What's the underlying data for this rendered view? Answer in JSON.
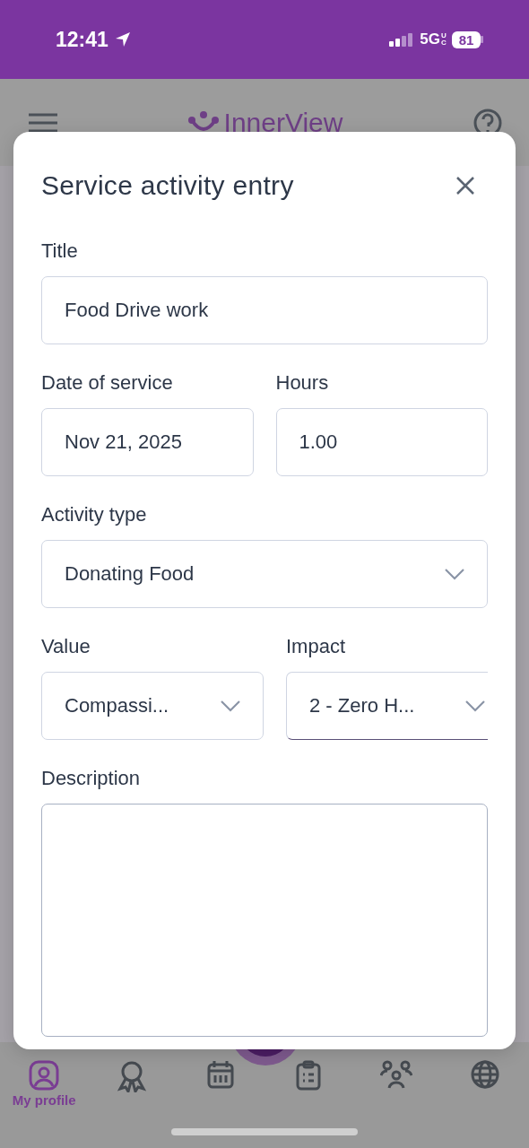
{
  "status_bar": {
    "time": "12:41",
    "network": "5G",
    "network_suffix": "UC",
    "battery": "81"
  },
  "app_header": {
    "logo": "InnerView"
  },
  "modal": {
    "title": "Service activity entry",
    "rows": [
      [
        {
          "kind": "text",
          "label": "Title",
          "value": "Food Drive work",
          "focused": false
        }
      ],
      [
        {
          "kind": "date",
          "label": "Date of service",
          "value": "Nov 21, 2025",
          "focused": false
        },
        {
          "kind": "number",
          "label": "Hours",
          "value": "1.00",
          "focused": false
        }
      ],
      [
        {
          "kind": "select",
          "label": "Activity type",
          "value": "Donating Food",
          "focused": false
        }
      ],
      [
        {
          "kind": "select",
          "label": "Value",
          "value": "Compassi...",
          "focused": false
        },
        {
          "kind": "select",
          "label": "Impact",
          "value": "2 - Zero H...",
          "focused": true
        }
      ],
      [
        {
          "kind": "textarea",
          "label": "Description",
          "focused": false
        }
      ]
    ]
  },
  "bottom_nav": {
    "items": [
      {
        "kind": "profile",
        "label": "My profile",
        "selected": true
      },
      {
        "kind": "award",
        "selected": false
      },
      {
        "kind": "calendar",
        "selected": false
      },
      {
        "kind": "clipboard",
        "selected": false
      },
      {
        "kind": "people",
        "selected": false
      },
      {
        "kind": "globe",
        "selected": false
      }
    ]
  }
}
